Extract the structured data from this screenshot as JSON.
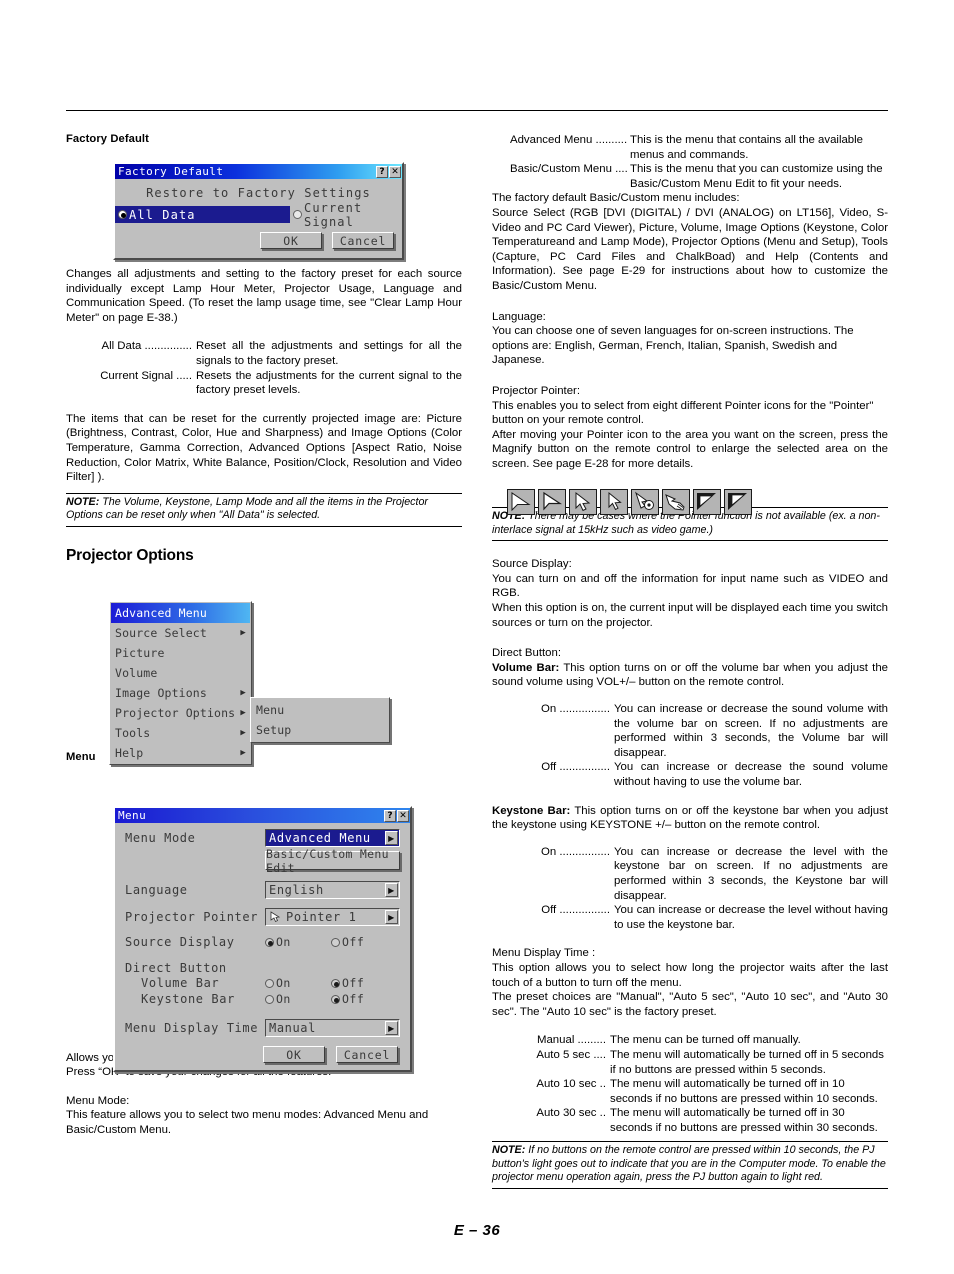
{
  "page": {
    "footer": "E – 36"
  },
  "left": {
    "heading_factory_default": "Factory Default",
    "factory_default_dialog": {
      "title": "Factory Default",
      "help_btn": "?",
      "close_btn": "✕",
      "subtitle": "Restore to Factory Settings",
      "option_all_data": "All Data",
      "option_current_signal": "Current Signal",
      "selected_option": "All Data",
      "ok_label": "OK",
      "cancel_label": "Cancel",
      "title_gradient_from": "#0000a8",
      "title_gradient_to": "#6fe8ff",
      "highlight_color": "#1b1b8f",
      "face_color": "#bfbfbf"
    },
    "para_changes": "Changes all adjustments and setting to the factory preset for each source individually except Lamp Hour Meter, Projector Usage, Language and Communication Speed. (To reset the lamp usage time, see \"Clear Lamp Hour Meter\" on page E-38.)",
    "defs": [
      {
        "term": "All Data ...............",
        "desc": "Reset all the adjustments and settings for all the signals to the factory preset."
      },
      {
        "term": "Current Signal .....",
        "desc": "Resets the adjustments for the current signal to the factory preset levels."
      }
    ],
    "para_items_reset": "The items that can be reset for the currently projected image are: Picture (Brightness, Contrast, Color, Hue and Sharpness) and Image Options (Color Temperature, Gamma Correction, Advanced Options [Aspect Ratio, Noise Reduction, Color Matrix, White Balance, Position/Clock, Resolution and Video Filter] ).",
    "note_1_label": "NOTE:",
    "note_1_text": " The Volume, Keystone, Lamp Mode and all the items in the Projector Options can be reset only when \"All Data\" is selected.",
    "heading_projector_options": "Projector Options",
    "advanced_menu": {
      "items": [
        {
          "label": "Advanced Menu",
          "arrow": "",
          "highlighted": true
        },
        {
          "label": "Source Select",
          "arrow": "▶",
          "highlighted": false
        },
        {
          "label": "Picture",
          "arrow": "",
          "highlighted": false
        },
        {
          "label": "Volume",
          "arrow": "",
          "highlighted": false
        },
        {
          "label": "Image Options",
          "arrow": "▶",
          "highlighted": false
        },
        {
          "label": "Projector Options",
          "arrow": "▶",
          "highlighted": false
        },
        {
          "label": "Tools",
          "arrow": "▶",
          "highlighted": false
        },
        {
          "label": "Help",
          "arrow": "▶",
          "highlighted": false
        }
      ],
      "submenu": [
        {
          "label": "Menu"
        },
        {
          "label": "Setup"
        }
      ]
    },
    "caption_menu": "Menu",
    "menu_dialog": {
      "title": "Menu",
      "help_btn": "?",
      "close_btn": "✕",
      "menu_mode_label": "Menu Mode",
      "menu_mode_value": "Advanced Menu",
      "basic_custom_edit_label": "Basic/Custom Menu Edit",
      "language_label": "Language",
      "language_value": "English",
      "projector_pointer_label": "Projector Pointer",
      "projector_pointer_value": "Pointer 1",
      "source_display_label": "Source Display",
      "source_display_on": "On",
      "source_display_off": "Off",
      "source_display_value": "On",
      "direct_button_label": "Direct Button",
      "volume_bar_label": "Volume Bar",
      "volume_bar_on": "On",
      "volume_bar_off": "Off",
      "volume_bar_value": "Off",
      "keystone_bar_label": "Keystone Bar",
      "keystone_bar_on": "On",
      "keystone_bar_off": "Off",
      "keystone_bar_value": "Off",
      "menu_display_time_label": "Menu Display Time",
      "menu_display_time_value": "Manual",
      "ok_label": "OK",
      "cancel_label": "Cancel",
      "spin_glyph": "▶"
    },
    "para_allows": "Allows you to set preferences for the on-screen menu.",
    "para_press_ok": "Press “OK” to save your changes for all the features.",
    "heading_menu_mode": "Menu Mode:",
    "para_menu_mode": "This feature allows you to select two menu modes: Advanced Menu and Basic/Custom Menu."
  },
  "right": {
    "defs_menu_modes": [
      {
        "term": "Advanced Menu ..........",
        "desc": "This is the menu that contains all the available menus and commands."
      },
      {
        "term": "Basic/Custom Menu ....",
        "desc": "This is the menu that you can customize using the Basic/Custom Menu Edit to fit your needs."
      }
    ],
    "para_factory_default_basic": "The factory default Basic/Custom menu includes:",
    "para_source_select": "Source Select (RGB [DVI (DIGITAL) / DVI (ANALOG) on LT156], Video, S-Video and PC Card Viewer), Picture, Volume, Image Options (Keystone, Color Temperatureand and Lamp Mode), Projector Options (Menu and Setup), Tools (Capture, PC Card Files and ChalkBoad) and Help (Contents and Information). See page E-29 for instructions about how to customize the Basic/Custom Menu.",
    "heading_language": "Language:",
    "para_language": "You can choose one of seven languages for on-screen instructions. The options are: English, German, French, Italian, Spanish, Swedish and Japanese.",
    "heading_projector_pointer": "Projector Pointer:",
    "para_pointer_1": "This enables you to select from eight different Pointer icons for the \"Pointer\" button on your remote control.",
    "para_pointer_2": "After moving your Pointer icon to the area you want on the screen, press the Magnify button on the remote control to enlarge the selected area on the screen. See page E-28 for more details.",
    "pointer_icons": [
      "pointer-arrow-thin-up-left",
      "pointer-arrow-outline-up-left",
      "pointer-arrow-solid-up-left",
      "pointer-arrow-hollow-up-left",
      "pointer-mouse",
      "pointer-hand",
      "pointer-wedge-down-left",
      "pointer-wedge-down-left-filled"
    ],
    "note_2_label": "NOTE:",
    "note_2_text": " There may be cases where the Pointer function is not available (ex. a non-interlace signal at 15kHz such as video game.)",
    "heading_source_display": "Source Display:",
    "para_source_display_1": "You can turn on and off the information for input name such as VIDEO and RGB.",
    "para_source_display_2": "When this option is on, the current input will be displayed each time you switch sources or turn on the projector.",
    "heading_direct_button": "Direct Button:",
    "volume_bar_bold": "Volume Bar:",
    "volume_bar_text": " This option turns on or off the volume bar when you adjust the sound volume using VOL+/– button on the remote control.",
    "defs_volume": [
      {
        "term": "On ................",
        "desc": "You can increase or decrease the sound volume with the volume bar on screen. If no adjustments are performed within 3 seconds, the Volume bar will disappear."
      },
      {
        "term": "Off ................",
        "desc": "You can increase or decrease the sound volume without having to use the volume bar."
      }
    ],
    "keystone_bar_bold": "Keystone Bar:",
    "keystone_bar_text": " This option turns on or off the keystone bar when you adjust the keystone using KEYSTONE +/– button on the remote control.",
    "defs_keystone": [
      {
        "term": "On ................",
        "desc": "You can increase or decrease the level with the keystone bar on screen. If no adjustments are performed within 3 seconds, the Keystone bar will disappear."
      },
      {
        "term": "Off ................",
        "desc": "You can increase or decrease the level without having to use the keystone bar."
      }
    ],
    "heading_menu_display_time": "Menu Display Time :",
    "para_mdt_1": "This option allows you to select how long the projector waits after the last touch of a button to turn off the menu.",
    "para_mdt_2": "The preset choices are \"Manual\", \"Auto 5 sec\", \"Auto 10 sec\", and \"Auto 30 sec\". The \"Auto 10 sec\" is the factory preset.",
    "defs_mdt": [
      {
        "term": "Manual .........",
        "desc": "The menu can be turned off manually."
      },
      {
        "term": "Auto 5 sec ....",
        "desc": "The menu will automatically be turned off in 5 seconds if no buttons are pressed within 5 seconds."
      },
      {
        "term": "Auto 10 sec ..",
        "desc": "The menu will automatically be turned off in 10 seconds if no buttons are pressed within 10 seconds."
      },
      {
        "term": "Auto 30 sec ..",
        "desc": "The menu will automatically be turned off in 30 seconds if no buttons are pressed within 30 seconds."
      }
    ],
    "note_3_label": "NOTE:",
    "note_3_text": " If no buttons on the remote control are pressed within 10 seconds, the PJ button's light goes out to indicate that you are in the Computer mode. To enable the projector menu operation again, press the PJ button again to light red."
  }
}
